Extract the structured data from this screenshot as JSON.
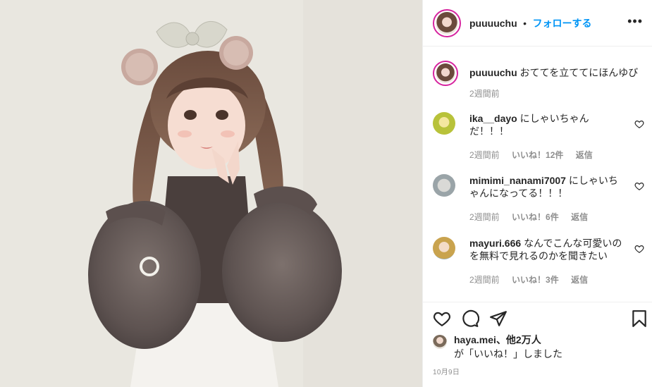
{
  "post": {
    "image_alt": "girl with twin tails wearing a bow headband and brown sheer puff-sleeve blouse"
  },
  "header": {
    "username": "puuuuchu",
    "separator": "•",
    "follow_label": "フォローする",
    "more_icon": "more-horizontal-icon"
  },
  "caption": {
    "username": "puuuuchu",
    "text": "おててを立ててにほんゆび",
    "time": "2週間前"
  },
  "comments": [
    {
      "username": "ika__dayo",
      "text": "にしゃいちゃんだ！！！",
      "time": "2週間前",
      "likes": "いいね！12件",
      "reply": "返信"
    },
    {
      "username": "mimimi_nanami7007",
      "text": "にしゃいちゃんになってる！！！",
      "time": "2週間前",
      "likes": "いいね！6件",
      "reply": "返信"
    },
    {
      "username": "mayuri.666",
      "text": "なんでこんな可愛いのを無料で見れるのかを聞きたい",
      "time": "2週間前",
      "likes": "いいね！3件",
      "reply": "返信"
    }
  ],
  "actions": {
    "like_icon": "heart-icon",
    "comment_icon": "comment-icon",
    "share_icon": "share-icon",
    "save_icon": "bookmark-icon"
  },
  "likes_summary": {
    "first_user": "haya.mei",
    "others": "、他2万人",
    "suffix": "が「いいね！」しました"
  },
  "date": "10月9日",
  "colors": {
    "accent": "#0095f6",
    "muted": "#8e8e8e",
    "text": "#262626",
    "border": "#efefef"
  }
}
